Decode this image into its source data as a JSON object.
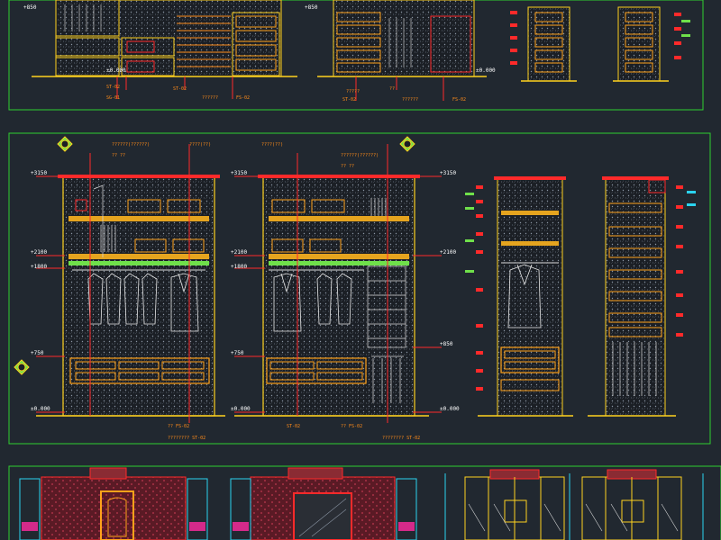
{
  "colors": {
    "background": "#212830",
    "sheet_frame": "#2fd12f",
    "cabinet_outline": "#ffd21f",
    "dimension_line": "#ff2a2a",
    "cabinet_fill": "#1c2026",
    "hatch": "#7f8a98",
    "drawer_box": "#ffa21a",
    "text_white": "#ffffff",
    "cyan": "#2bd3f0",
    "magenta": "#d42a8a",
    "badge_green": "#6fe04a"
  },
  "icons": {
    "section_marker": "elevation-marker-icon",
    "hanger": "hanger-icon",
    "garment": "garment-icon"
  },
  "top_panels": {
    "left": {
      "level_top": "+850",
      "level_base": "±0.000",
      "tags": [
        "ST-02",
        "SG-01",
        "ST-02",
        "??????",
        "??",
        "FS-02"
      ]
    },
    "middle": {
      "level_top": "+850",
      "level_base": "±0.000",
      "tags": [
        "?????",
        "??",
        "ST-02",
        "??????",
        "FS-02"
      ]
    }
  },
  "main_panels": {
    "elev1": {
      "levels": [
        "+3150",
        "+2100",
        "+1800",
        "+750",
        "±0.000"
      ],
      "callouts": [
        "??????(??????)",
        "?? ??",
        "????(??)",
        "?? FS-02",
        "???????? ST-02",
        "?? FS-02"
      ],
      "badge": "ST-02"
    },
    "elev2": {
      "levels": [
        "+3150",
        "+2100",
        "+1800",
        "+750",
        "±0.000"
      ],
      "levels_right": [
        "+3150",
        "+2100",
        "+850",
        "±0.000"
      ],
      "callouts": [
        "????(??)",
        "??????(??????)",
        "?? ??",
        "ST-02",
        "?? FS-02",
        "???????? ST-02"
      ],
      "badge": "ST-02"
    }
  }
}
